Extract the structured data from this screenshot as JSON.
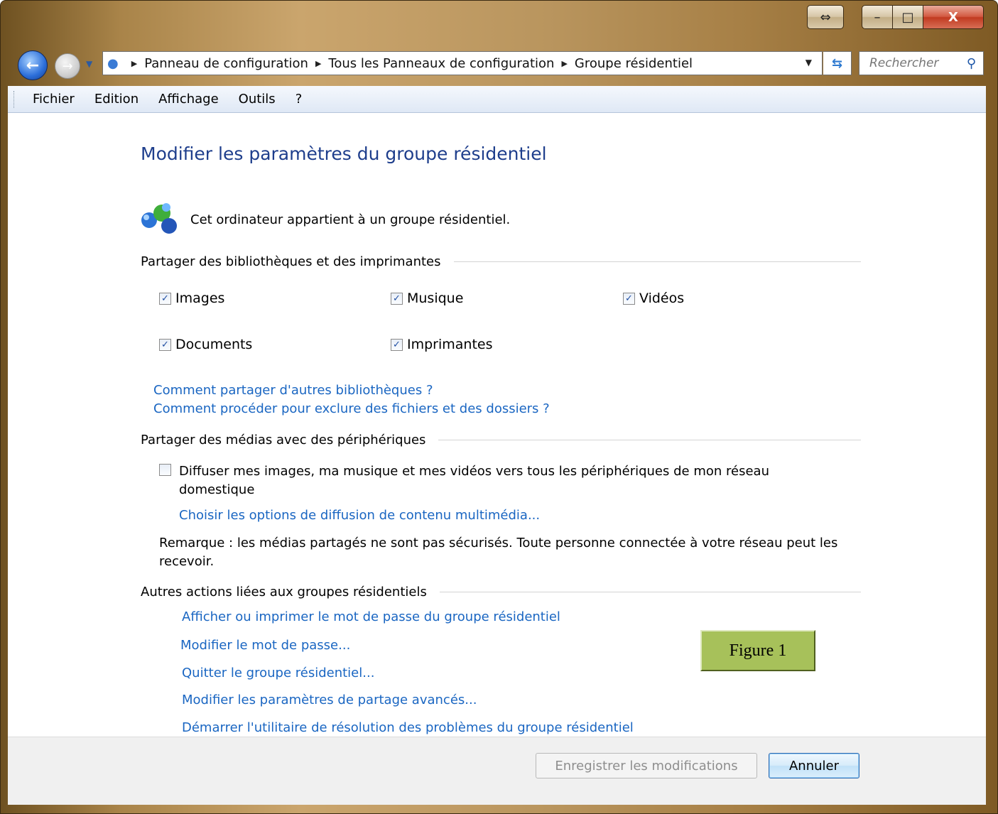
{
  "titlebar": {
    "snap_icon": "⇔",
    "minimize_icon": "–",
    "maximize_icon": "□",
    "close_icon": "X"
  },
  "nav": {
    "back_icon": "back-arrow-icon",
    "forward_icon": "forward-arrow-icon",
    "breadcrumbs": [
      "Panneau de configuration",
      "Tous les Panneaux de configuration",
      "Groupe résidentiel"
    ],
    "search_placeholder": "Rechercher"
  },
  "menu": [
    "Fichier",
    "Edition",
    "Affichage",
    "Outils",
    "?"
  ],
  "main": {
    "title": "Modifier les paramètres du groupe résidentiel",
    "membership_text": "Cet ordinateur appartient à un groupe résidentiel.",
    "share_section": {
      "heading": "Partager des bibliothèques et des imprimantes",
      "items": [
        {
          "label": "Images",
          "checked": true
        },
        {
          "label": "Musique",
          "checked": true
        },
        {
          "label": "Vidéos",
          "checked": true
        },
        {
          "label": "Documents",
          "checked": true
        },
        {
          "label": "Imprimantes",
          "checked": true
        }
      ],
      "links": [
        "Comment partager d'autres bibliothèques ?",
        "Comment procéder pour exclure des fichiers et des dossiers ?"
      ]
    },
    "media_section": {
      "heading": "Partager des médias avec des périphériques",
      "stream_label_line1": "Diffuser mes images, ma musique et mes vidéos vers tous les périphériques de mon réseau",
      "stream_label_line2": "domestique",
      "stream_checked": false,
      "options_link": "Choisir les options de diffusion de contenu multimédia...",
      "note_line1": "Remarque : les médias partagés ne sont pas sécurisés. Toute personne connectée à votre réseau peut les",
      "note_line2": "recevoir."
    },
    "other_section": {
      "heading": "Autres actions liées aux groupes résidentiels",
      "links": [
        "Afficher ou imprimer le mot de passe du groupe résidentiel",
        "Modifier le mot de passe...",
        "Quitter le groupe résidentiel...",
        "Modifier les paramètres de partage avancés...",
        "Démarrer l'utilitaire de résolution des problèmes du groupe résidentiel"
      ]
    },
    "figure_label": "Figure 1"
  },
  "footer": {
    "save_label": "Enregistrer les modifications",
    "cancel_label": "Annuler"
  }
}
